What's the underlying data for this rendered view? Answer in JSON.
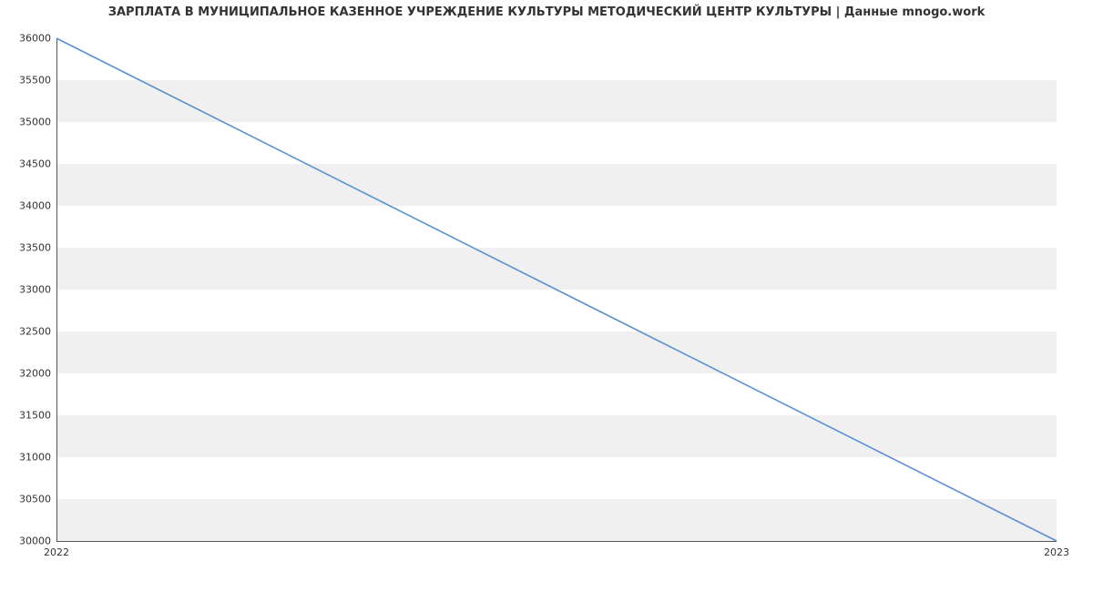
{
  "chart_data": {
    "type": "line",
    "title": "ЗАРПЛАТА В МУНИЦИПАЛЬНОЕ КАЗЕННОЕ УЧРЕЖДЕНИЕ КУЛЬТУРЫ МЕТОДИЧЕСКИЙ ЦЕНТР КУЛЬТУРЫ | Данные mnogo.work",
    "xlabel": "",
    "ylabel": "",
    "x_categories": [
      "2022",
      "2023"
    ],
    "x": [
      2022,
      2023
    ],
    "values": [
      36000,
      30000
    ],
    "ylim": [
      30000,
      36000
    ],
    "yticks": [
      30000,
      30500,
      31000,
      31500,
      32000,
      32500,
      33000,
      33500,
      34000,
      34500,
      35000,
      35500,
      36000
    ],
    "grid_bands": true,
    "line_color": "#5b8fd6"
  }
}
